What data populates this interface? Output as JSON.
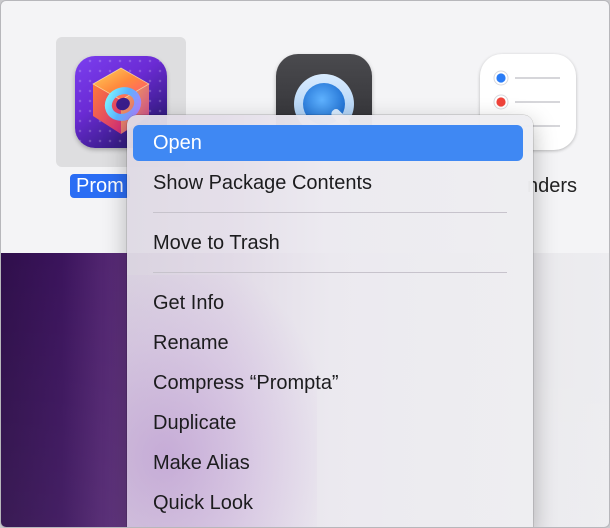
{
  "files": [
    {
      "name": "Prompta",
      "label_visible": "Prom",
      "icon": "prompta-app-icon",
      "selected": true
    },
    {
      "name": "QuickTime Player",
      "icon": "quicktime-app-icon",
      "selected": false
    },
    {
      "name": "Reminders",
      "label_visible": "nders",
      "icon": "reminders-app-icon",
      "selected": false
    }
  ],
  "context_menu": {
    "items": [
      {
        "label": "Open",
        "active": true
      },
      {
        "label": "Show Package Contents"
      },
      {
        "label": "Move to Trash"
      },
      {
        "label": "Get Info"
      },
      {
        "label": "Rename"
      },
      {
        "label": "Compress “Prompta”"
      },
      {
        "label": "Duplicate"
      },
      {
        "label": "Make Alias"
      },
      {
        "label": "Quick Look"
      }
    ]
  },
  "colors": {
    "selection_blue": "#2a6df4",
    "menu_highlight": "#3f88f3",
    "desktop_purple": "#2f0f4b"
  }
}
